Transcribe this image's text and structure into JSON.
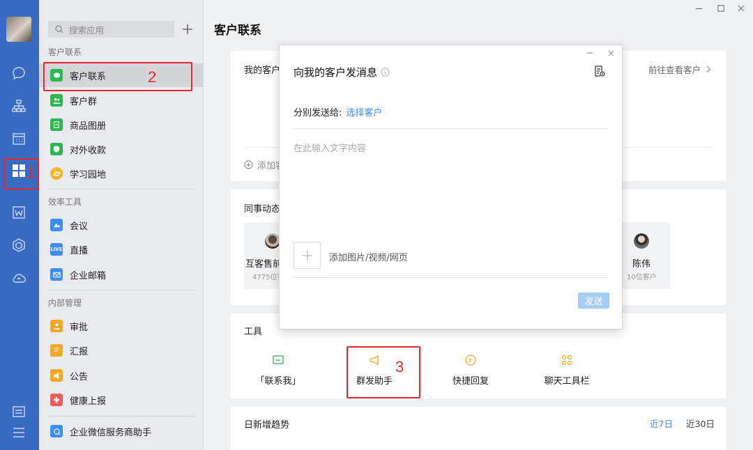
{
  "window_controls": {
    "min": "—",
    "max": "☐",
    "close": "✕"
  },
  "sidebar": {
    "search_placeholder": "搜索应用",
    "sections": [
      {
        "title": "客户联系",
        "items": [
          {
            "label": "客户联系",
            "color": "#2fb653"
          },
          {
            "label": "客户群",
            "color": "#2fb653"
          },
          {
            "label": "商品图册",
            "color": "#2fb653"
          },
          {
            "label": "对外收款",
            "color": "#2fb653"
          },
          {
            "label": "学习园地",
            "color": "#f3b626"
          }
        ]
      },
      {
        "title": "效率工具",
        "items": [
          {
            "label": "会议",
            "color": "#3d8ef0"
          },
          {
            "label": "直播",
            "color": "#3d8ef0",
            "badge": "LIVE"
          },
          {
            "label": "企业邮箱",
            "color": "#3d8ef0"
          }
        ]
      },
      {
        "title": "内部管理",
        "items": [
          {
            "label": "审批",
            "color": "#f3a826"
          },
          {
            "label": "汇报",
            "color": "#f3a826"
          },
          {
            "label": "公告",
            "color": "#f3a826"
          },
          {
            "label": "健康上报",
            "color": "#f25b5b"
          }
        ]
      }
    ],
    "footer_item": "企业微信服务商助手"
  },
  "main": {
    "title": "客户联系",
    "my_customers": {
      "title": "我的客户",
      "goto": "前往查看客户",
      "add": "添加客户"
    },
    "colleagues": {
      "title": "同事动态",
      "left_person": {
        "name": "互客售前",
        "count": "4775位客户"
      },
      "right_person": {
        "name": "陈伟",
        "count": "10位客户"
      }
    },
    "tools": {
      "title": "工具",
      "items": [
        "「联系我」",
        "群发助手",
        "快捷回复",
        "聊天工具栏"
      ]
    },
    "trend": {
      "title": "日新增趋势",
      "ranges": [
        "近7日",
        "近30日"
      ]
    }
  },
  "modal": {
    "title": "向我的客户发消息",
    "send_to_label": "分别发送给:",
    "select_customer": "选择客户",
    "text_placeholder": "在此输入文字内容",
    "attach_label": "添加图片/视频/网页",
    "send_button": "发送"
  },
  "annotations": [
    "1",
    "2",
    "3"
  ],
  "colors": {
    "rail": "#3a6bc2",
    "accent": "#3d8ef0",
    "annotation": "#e8262b"
  }
}
